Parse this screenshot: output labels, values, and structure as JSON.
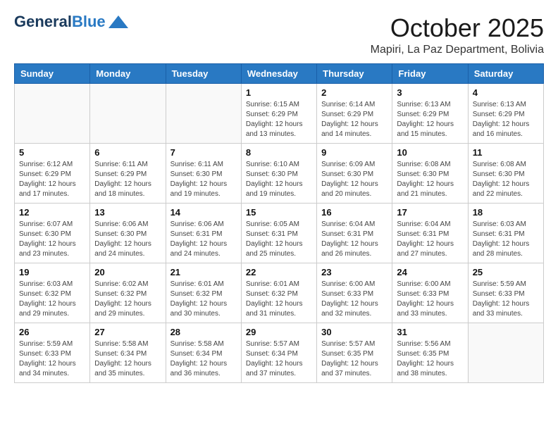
{
  "header": {
    "logo_general": "General",
    "logo_blue": "Blue",
    "month_year": "October 2025",
    "location": "Mapiri, La Paz Department, Bolivia"
  },
  "days_of_week": [
    "Sunday",
    "Monday",
    "Tuesday",
    "Wednesday",
    "Thursday",
    "Friday",
    "Saturday"
  ],
  "weeks": [
    [
      {
        "day": "",
        "info": ""
      },
      {
        "day": "",
        "info": ""
      },
      {
        "day": "",
        "info": ""
      },
      {
        "day": "1",
        "info": "Sunrise: 6:15 AM\nSunset: 6:29 PM\nDaylight: 12 hours\nand 13 minutes."
      },
      {
        "day": "2",
        "info": "Sunrise: 6:14 AM\nSunset: 6:29 PM\nDaylight: 12 hours\nand 14 minutes."
      },
      {
        "day": "3",
        "info": "Sunrise: 6:13 AM\nSunset: 6:29 PM\nDaylight: 12 hours\nand 15 minutes."
      },
      {
        "day": "4",
        "info": "Sunrise: 6:13 AM\nSunset: 6:29 PM\nDaylight: 12 hours\nand 16 minutes."
      }
    ],
    [
      {
        "day": "5",
        "info": "Sunrise: 6:12 AM\nSunset: 6:29 PM\nDaylight: 12 hours\nand 17 minutes."
      },
      {
        "day": "6",
        "info": "Sunrise: 6:11 AM\nSunset: 6:29 PM\nDaylight: 12 hours\nand 18 minutes."
      },
      {
        "day": "7",
        "info": "Sunrise: 6:11 AM\nSunset: 6:30 PM\nDaylight: 12 hours\nand 19 minutes."
      },
      {
        "day": "8",
        "info": "Sunrise: 6:10 AM\nSunset: 6:30 PM\nDaylight: 12 hours\nand 19 minutes."
      },
      {
        "day": "9",
        "info": "Sunrise: 6:09 AM\nSunset: 6:30 PM\nDaylight: 12 hours\nand 20 minutes."
      },
      {
        "day": "10",
        "info": "Sunrise: 6:08 AM\nSunset: 6:30 PM\nDaylight: 12 hours\nand 21 minutes."
      },
      {
        "day": "11",
        "info": "Sunrise: 6:08 AM\nSunset: 6:30 PM\nDaylight: 12 hours\nand 22 minutes."
      }
    ],
    [
      {
        "day": "12",
        "info": "Sunrise: 6:07 AM\nSunset: 6:30 PM\nDaylight: 12 hours\nand 23 minutes."
      },
      {
        "day": "13",
        "info": "Sunrise: 6:06 AM\nSunset: 6:30 PM\nDaylight: 12 hours\nand 24 minutes."
      },
      {
        "day": "14",
        "info": "Sunrise: 6:06 AM\nSunset: 6:31 PM\nDaylight: 12 hours\nand 24 minutes."
      },
      {
        "day": "15",
        "info": "Sunrise: 6:05 AM\nSunset: 6:31 PM\nDaylight: 12 hours\nand 25 minutes."
      },
      {
        "day": "16",
        "info": "Sunrise: 6:04 AM\nSunset: 6:31 PM\nDaylight: 12 hours\nand 26 minutes."
      },
      {
        "day": "17",
        "info": "Sunrise: 6:04 AM\nSunset: 6:31 PM\nDaylight: 12 hours\nand 27 minutes."
      },
      {
        "day": "18",
        "info": "Sunrise: 6:03 AM\nSunset: 6:31 PM\nDaylight: 12 hours\nand 28 minutes."
      }
    ],
    [
      {
        "day": "19",
        "info": "Sunrise: 6:03 AM\nSunset: 6:32 PM\nDaylight: 12 hours\nand 29 minutes."
      },
      {
        "day": "20",
        "info": "Sunrise: 6:02 AM\nSunset: 6:32 PM\nDaylight: 12 hours\nand 29 minutes."
      },
      {
        "day": "21",
        "info": "Sunrise: 6:01 AM\nSunset: 6:32 PM\nDaylight: 12 hours\nand 30 minutes."
      },
      {
        "day": "22",
        "info": "Sunrise: 6:01 AM\nSunset: 6:32 PM\nDaylight: 12 hours\nand 31 minutes."
      },
      {
        "day": "23",
        "info": "Sunrise: 6:00 AM\nSunset: 6:33 PM\nDaylight: 12 hours\nand 32 minutes."
      },
      {
        "day": "24",
        "info": "Sunrise: 6:00 AM\nSunset: 6:33 PM\nDaylight: 12 hours\nand 33 minutes."
      },
      {
        "day": "25",
        "info": "Sunrise: 5:59 AM\nSunset: 6:33 PM\nDaylight: 12 hours\nand 33 minutes."
      }
    ],
    [
      {
        "day": "26",
        "info": "Sunrise: 5:59 AM\nSunset: 6:33 PM\nDaylight: 12 hours\nand 34 minutes."
      },
      {
        "day": "27",
        "info": "Sunrise: 5:58 AM\nSunset: 6:34 PM\nDaylight: 12 hours\nand 35 minutes."
      },
      {
        "day": "28",
        "info": "Sunrise: 5:58 AM\nSunset: 6:34 PM\nDaylight: 12 hours\nand 36 minutes."
      },
      {
        "day": "29",
        "info": "Sunrise: 5:57 AM\nSunset: 6:34 PM\nDaylight: 12 hours\nand 37 minutes."
      },
      {
        "day": "30",
        "info": "Sunrise: 5:57 AM\nSunset: 6:35 PM\nDaylight: 12 hours\nand 37 minutes."
      },
      {
        "day": "31",
        "info": "Sunrise: 5:56 AM\nSunset: 6:35 PM\nDaylight: 12 hours\nand 38 minutes."
      },
      {
        "day": "",
        "info": ""
      }
    ]
  ]
}
